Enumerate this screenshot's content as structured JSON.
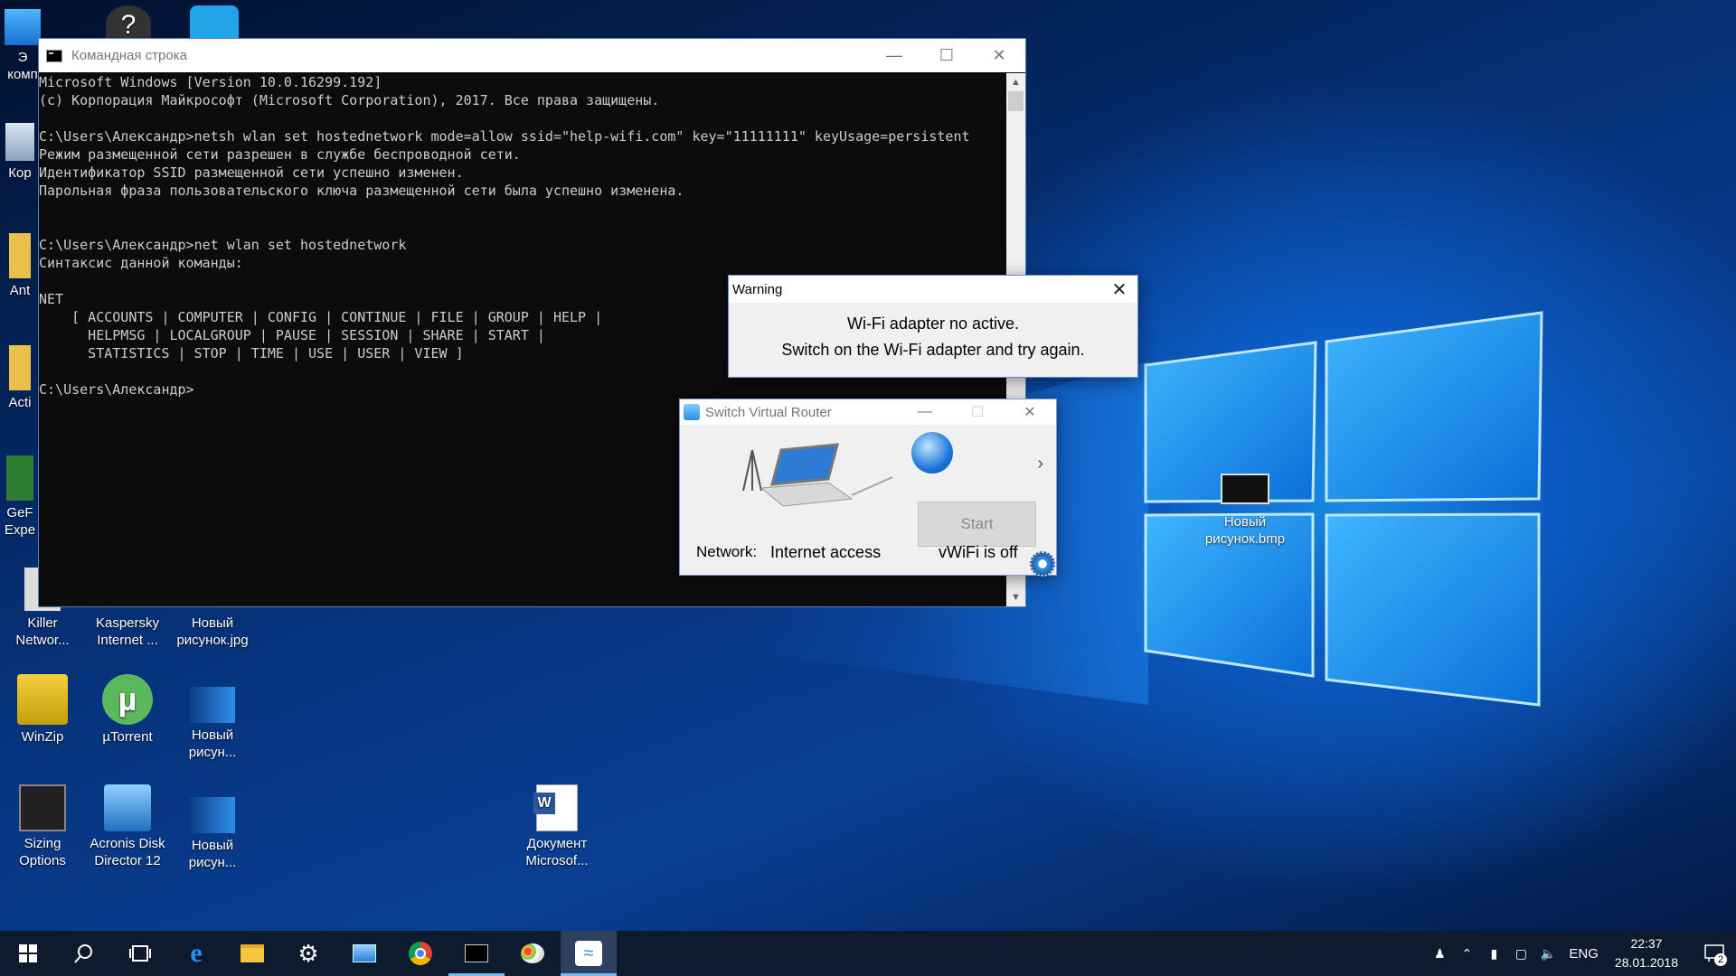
{
  "desktop": {
    "icons": [
      {
        "name": "desktop-icon-this-pc",
        "label": "Э\nкомп"
      },
      {
        "name": "desktop-icon-recycle",
        "label": "Кор"
      },
      {
        "name": "desktop-icon-ant",
        "label": "Ant"
      },
      {
        "name": "desktop-icon-acti",
        "label": "Acti"
      },
      {
        "name": "desktop-icon-geforce",
        "label": "GeF\nExpe"
      },
      {
        "name": "desktop-icon-killer",
        "label": "Killer Networ..."
      },
      {
        "name": "desktop-icon-kaspersky",
        "label": "Kaspersky Internet ..."
      },
      {
        "name": "desktop-icon-new-jpg",
        "label": "Новый рисунок.jpg"
      },
      {
        "name": "desktop-icon-winzip",
        "label": "WinZip"
      },
      {
        "name": "desktop-icon-utorrent",
        "label": "µTorrent"
      },
      {
        "name": "desktop-icon-new-pic-1",
        "label": "Новый рисун..."
      },
      {
        "name": "desktop-icon-sizing",
        "label": "Sizing Options"
      },
      {
        "name": "desktop-icon-acronis",
        "label": "Acronis Disk Director 12"
      },
      {
        "name": "desktop-icon-new-pic-2",
        "label": "Новый рисун..."
      },
      {
        "name": "desktop-icon-word-doc",
        "label": "Документ Microsof..."
      },
      {
        "name": "desktop-icon-new-bmp",
        "label": "Новый рисунок.bmp"
      }
    ]
  },
  "cmd": {
    "title": "Командная строка",
    "console": "Microsoft Windows [Version 10.0.16299.192]\n(c) Корпорация Майкрософт (Microsoft Corporation), 2017. Все права защищены.\n\nC:\\Users\\Александр>netsh wlan set hostednetwork mode=allow ssid=\"help-wifi.com\" key=\"11111111\" keyUsage=persistent\nРежим размещенной сети разрешен в службе беспроводной сети.\nИдентификатор SSID размещенной сети успешно изменен.\nПарольная фраза пользовательского ключа размещенной сети была успешно изменена.\n\n\nC:\\Users\\Александр>net wlan set hostednetwork\nСинтаксис данной команды:\n\nNET\n    [ ACCOUNTS | COMPUTER | CONFIG | CONTINUE | FILE | GROUP | HELP |\n      HELPMSG | LOCALGROUP | PAUSE | SESSION | SHARE | START |\n      STATISTICS | STOP | TIME | USE | USER | VIEW ]\n\nC:\\Users\\Александр>"
  },
  "warning": {
    "title": "Warning",
    "line1": "Wi-Fi adapter no active.",
    "line2": "Switch on the Wi-Fi adapter and try again."
  },
  "svr": {
    "title": "Switch Virtual Router",
    "start_label": "Start",
    "network_label": "Network:",
    "network_value": "Internet access",
    "status": "vWiFi is off"
  },
  "taskbar": {
    "lang": "ENG",
    "time": "22:37",
    "date": "28.01.2018",
    "notifications": "2"
  }
}
